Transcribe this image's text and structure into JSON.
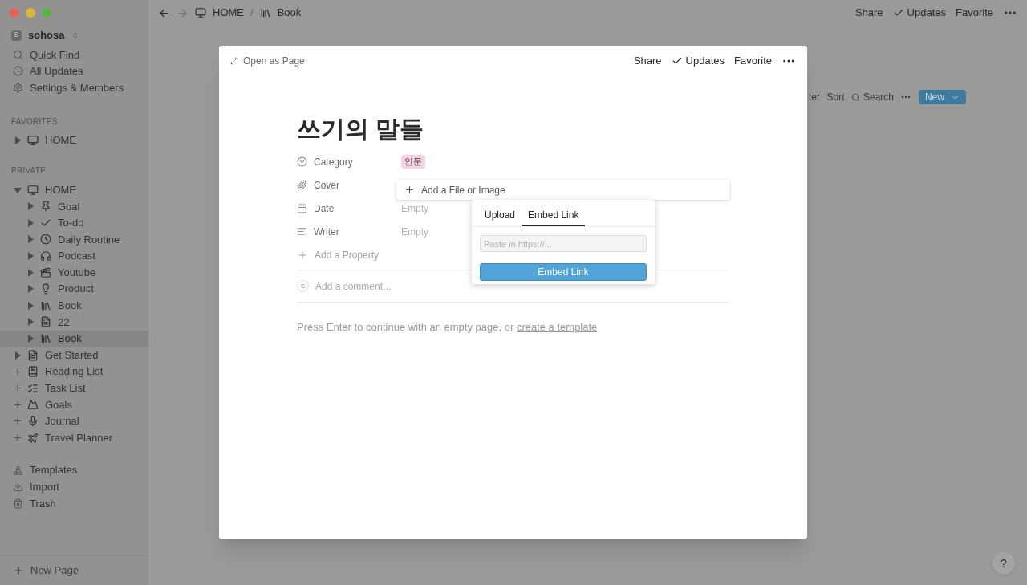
{
  "sidebar": {
    "workspace": {
      "initial": "S",
      "name": "sohosa"
    },
    "nav": [
      {
        "label": "Quick Find"
      },
      {
        "label": "All Updates"
      },
      {
        "label": "Settings & Members"
      }
    ],
    "favorites": {
      "heading": "FAVORITES",
      "items": [
        {
          "label": "HOME",
          "kind": "page",
          "expanded": false,
          "selected": false
        }
      ]
    },
    "private": {
      "heading": "PRIVATE",
      "items": [
        {
          "label": "HOME",
          "kind": "page",
          "expanded": true,
          "selected": false,
          "children": [
            {
              "label": "Goal",
              "kind": "page",
              "expanded": false,
              "selected": false
            },
            {
              "label": "To-do",
              "kind": "page",
              "expanded": false,
              "selected": false
            },
            {
              "label": "Daily Routine",
              "kind": "page",
              "expanded": false,
              "selected": false
            },
            {
              "label": "Podcast",
              "kind": "page",
              "expanded": false,
              "selected": false
            },
            {
              "label": "Youtube",
              "kind": "page",
              "expanded": false,
              "selected": false
            },
            {
              "label": "Product",
              "kind": "page",
              "expanded": false,
              "selected": false
            },
            {
              "label": "Book",
              "kind": "page",
              "expanded": false,
              "selected": false
            },
            {
              "label": "22",
              "kind": "page",
              "expanded": false,
              "selected": false
            },
            {
              "label": "Book",
              "kind": "page",
              "expanded": false,
              "selected": true
            }
          ]
        },
        {
          "label": "Get Started",
          "kind": "page",
          "expanded": false,
          "selected": false
        },
        {
          "label": "Reading List",
          "kind": "template",
          "selected": false
        },
        {
          "label": "Task List",
          "kind": "template",
          "selected": false
        },
        {
          "label": "Goals",
          "kind": "template",
          "selected": false
        },
        {
          "label": "Journal",
          "kind": "template",
          "selected": false
        },
        {
          "label": "Travel Planner",
          "kind": "template",
          "selected": false
        }
      ]
    },
    "bottom": [
      {
        "label": "Templates"
      },
      {
        "label": "Import"
      },
      {
        "label": "Trash"
      }
    ],
    "new_page": "New Page"
  },
  "topbar": {
    "breadcrumbs": [
      "HOME",
      "Book"
    ],
    "separator": "/",
    "actions": [
      {
        "label": "Share",
        "kind": "text"
      },
      {
        "label": "Updates",
        "kind": "check"
      },
      {
        "label": "Favorite",
        "kind": "text"
      }
    ]
  },
  "background_toolbar": {
    "items": [
      "ter",
      "Sort",
      "Search"
    ],
    "new_button": "New"
  },
  "modal": {
    "open_as_page": "Open as Page",
    "actions": [
      {
        "label": "Share",
        "kind": "text"
      },
      {
        "label": "Updates",
        "kind": "check"
      },
      {
        "label": "Favorite",
        "kind": "text"
      }
    ],
    "title": "쓰기의 말들",
    "properties": [
      {
        "name": "Category",
        "kind": "select",
        "value": "인문",
        "color": "#f5d1e3"
      },
      {
        "name": "Cover",
        "kind": "file"
      },
      {
        "name": "Date",
        "kind": "date",
        "value": "Empty"
      },
      {
        "name": "Writer",
        "kind": "text",
        "value": "Empty"
      }
    ],
    "add_property": "Add a Property",
    "comment": {
      "avatar": "S",
      "placeholder": "Add a comment..."
    },
    "hint": "Press Enter to continue with an empty page, or ",
    "hint_link": "create a template"
  },
  "file_popup": {
    "add_label": "Add a File or Image",
    "tabs": [
      {
        "label": "Upload",
        "selected": false
      },
      {
        "label": "Embed Link",
        "selected": true
      }
    ],
    "input": {
      "placeholder": "Paste in https://..."
    },
    "button": "Embed Link"
  },
  "help": "?"
}
